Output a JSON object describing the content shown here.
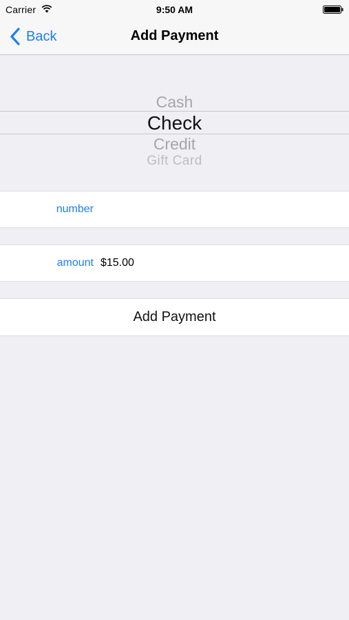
{
  "status_bar": {
    "carrier": "Carrier",
    "time": "9:50 AM",
    "wifi_icon": "wifi-icon",
    "battery_icon": "battery-icon"
  },
  "nav": {
    "back_label": "Back",
    "back_icon": "chevron-left-icon",
    "title": "Add Payment"
  },
  "picker": {
    "options": [
      "Cash",
      "Check",
      "Credit",
      "Gift Card"
    ],
    "selected": "Check"
  },
  "form": {
    "number": {
      "label": "number",
      "value": "",
      "placeholder": ""
    },
    "amount": {
      "label": "amount",
      "value": "$15.00"
    },
    "submit_label": "Add Payment"
  },
  "colors": {
    "accent": "#1a7ff5",
    "background": "#efeff4",
    "separator": "#c8c7cc"
  }
}
